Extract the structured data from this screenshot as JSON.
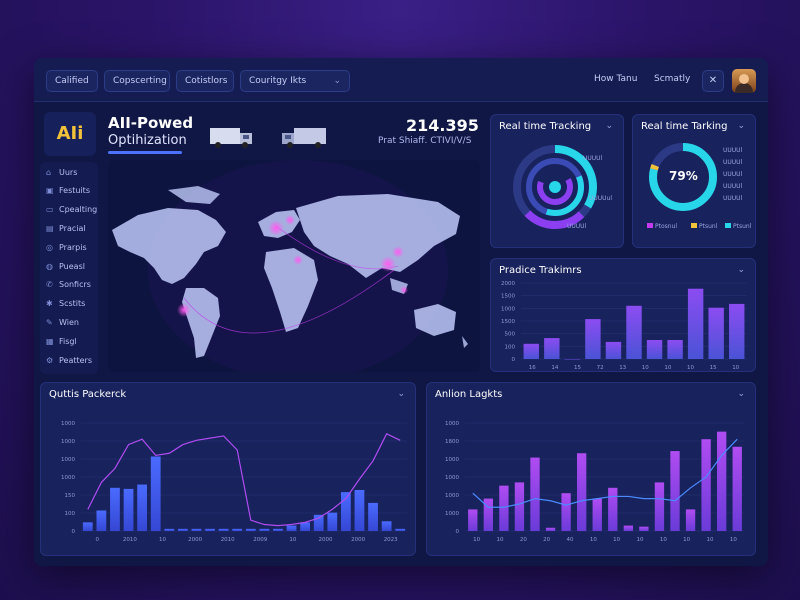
{
  "topbar": {
    "pills": [
      "Calified",
      "Copscerting",
      "Cotistlors",
      "Couritgy Ikts"
    ],
    "links": [
      "How Tanu",
      "Scmatly"
    ],
    "user_icon": "user-icon",
    "avatar": "avatar"
  },
  "brand": {
    "logo_text": "AIi",
    "title_line1": "AII-Powed",
    "title_line2": "Optihization"
  },
  "kpi": {
    "value": "214.395",
    "subtitle": "Prat Shiaff. CTIVI/V/S"
  },
  "sidebar": {
    "items": [
      {
        "icon": "home-icon",
        "label": "Uurs"
      },
      {
        "icon": "box-icon",
        "label": "Festuits"
      },
      {
        "icon": "truck-icon",
        "label": "Cpealting"
      },
      {
        "icon": "file-icon",
        "label": "Pracial"
      },
      {
        "icon": "users-icon",
        "label": "Prarpis"
      },
      {
        "icon": "chart-icon",
        "label": "Pueasl"
      },
      {
        "icon": "phone-icon",
        "label": "Sonficrs"
      },
      {
        "icon": "gear-icon",
        "label": "Scstits"
      },
      {
        "icon": "tool-icon",
        "label": "Wien"
      },
      {
        "icon": "doc-icon",
        "label": "Fisgl"
      },
      {
        "icon": "settings-icon",
        "label": "Peatters"
      }
    ]
  },
  "cards": {
    "tracking1": {
      "title": "Real time Tracking",
      "labels": [
        "UUUUl",
        "UUUUul",
        "UUUUl"
      ]
    },
    "tracking2": {
      "title": "Real time Tarking",
      "percent": "79%",
      "legend": [
        "UUUUl",
        "UUUUl",
        "UUUUl",
        "UUUUl",
        "UUUUl"
      ],
      "bottom_legend": [
        "Ptosnul",
        "Ptsunl",
        "Ptsunl"
      ]
    },
    "practice": {
      "title": "Pradice Trakimrs"
    },
    "outputs": {
      "title": "Quttis Packerck"
    },
    "anlion": {
      "title": "Anlion Lagkts"
    }
  },
  "chart_data": [
    {
      "type": "bar",
      "title": "Pradice Trakimrs",
      "ytick_labels": [
        "2000",
        "1500",
        "1000",
        "1500",
        "500",
        "100",
        "0"
      ],
      "xtick_labels": [
        "16",
        "14",
        "15",
        "72",
        "13",
        "10",
        "10",
        "10",
        "15",
        "10"
      ],
      "values": [
        8,
        11,
        0,
        21,
        9,
        28,
        10,
        10,
        37,
        27,
        29
      ],
      "ylim": [
        0,
        40
      ]
    },
    {
      "type": "bar",
      "title": "Quttis Packerck",
      "ytick_labels": [
        "1000",
        "1000",
        "1000",
        "1000",
        "150",
        "100",
        "0"
      ],
      "xtick_labels": [
        "0",
        "2010",
        "10",
        "2000",
        "2010",
        "2009",
        "10",
        "2000",
        "2000",
        "2023"
      ],
      "values": [
        8,
        19,
        40,
        39,
        43,
        69,
        2,
        2,
        2,
        2,
        2,
        2,
        2,
        2,
        2,
        5,
        8,
        15,
        17,
        36,
        38,
        26,
        9,
        2
      ],
      "line": [
        20,
        45,
        58,
        80,
        85,
        70,
        72,
        80,
        84,
        86,
        88,
        75,
        10,
        6,
        5,
        6,
        8,
        12,
        20,
        30,
        48,
        65,
        90,
        84
      ],
      "ylim": [
        0,
        100
      ]
    },
    {
      "type": "bar",
      "title": "Anlion Lagkts",
      "ytick_labels": [
        "1000",
        "1800",
        "1000",
        "1000",
        "1000",
        "1000",
        "0"
      ],
      "xtick_labels": [
        "10",
        "10",
        "20",
        "20",
        "40",
        "10",
        "10",
        "10",
        "10",
        "10",
        "10",
        "10"
      ],
      "values": [
        20,
        30,
        42,
        45,
        68,
        3,
        35,
        72,
        30,
        40,
        5,
        4,
        45,
        74,
        20,
        85,
        92,
        78
      ],
      "line": [
        35,
        22,
        22,
        25,
        30,
        28,
        24,
        28,
        30,
        32,
        32,
        30,
        30,
        28,
        40,
        50,
        70,
        85
      ],
      "ylim": [
        0,
        100
      ]
    }
  ],
  "colors": {
    "accent": "#4b73ff",
    "purple": "#8c3ff0",
    "teal": "#27d6e8",
    "magenta": "#c43bef"
  }
}
